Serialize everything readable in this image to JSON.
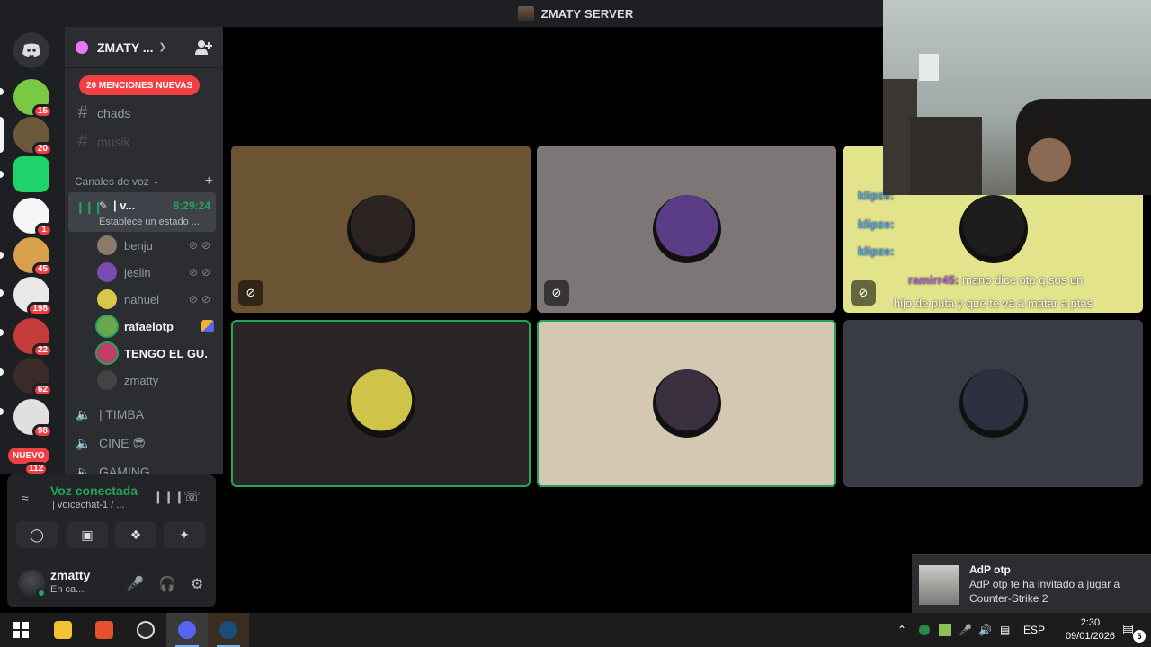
{
  "window": {
    "title": "ZMATY SERVER"
  },
  "servers": [
    {
      "badge": "15",
      "color": "#7ac943"
    },
    {
      "badge": "20",
      "color": "#6a5a3a"
    },
    {
      "badge": "",
      "color": "#1fd36a"
    },
    {
      "badge": "1",
      "color": "#f5f5f5"
    },
    {
      "badge": "45",
      "color": "#d8a04a"
    },
    {
      "badge": "198",
      "color": "#e8e8e8"
    },
    {
      "badge": "22",
      "color": "#c43b3b"
    },
    {
      "badge": "62",
      "color": "#3a2a2a"
    },
    {
      "badge": "98",
      "color": "#e0e0e0"
    }
  ],
  "rail": {
    "nuevo_label": "NUEVO",
    "nuevo_count": "112"
  },
  "sidebar": {
    "server_name": "ZMATY ...",
    "mentions_label": "20 MENCIONES NUEVAS",
    "text_channels": [
      {
        "name": "chads"
      },
      {
        "name": "musik"
      }
    ],
    "voice_category": "Canales de voz",
    "active_voice": {
      "name": "| v...",
      "timer": "8:29:24",
      "status": "Establece un estado ..."
    },
    "voice_users": [
      {
        "name": "benju",
        "color": "#8a7a6a"
      },
      {
        "name": "jeslin",
        "color": "#7a4bb0"
      },
      {
        "name": "nahuel",
        "color": "#d6c94a"
      },
      {
        "name": "rafaelotp",
        "color": "#6aa84f"
      },
      {
        "name": "TENGO EL GU...",
        "color": "#c23b6a"
      },
      {
        "name": "zmatty",
        "color": "#444"
      }
    ],
    "voice_channels": [
      {
        "name": "| TIMBA"
      },
      {
        "name": "CINE 😎"
      },
      {
        "name": "GAMING"
      }
    ]
  },
  "voice_panel": {
    "title": "Voz conectada",
    "subtitle": "| voicechat-1 / ...",
    "username": "zmatty",
    "user_status": "En ca..."
  },
  "tiles": [
    {
      "bg": "#6b5434",
      "ava": "#2b2421",
      "speaking": false,
      "camoff": true
    },
    {
      "bg": "#7d7676",
      "ava": "#5a3c87",
      "speaking": false,
      "camoff": true
    },
    {
      "bg": "#e2e38a",
      "ava": "#1d1d1d",
      "speaking": false,
      "camoff": true
    },
    {
      "bg": "#2a2627",
      "ava": "#cfc44a",
      "speaking": true,
      "camoff": false
    },
    {
      "bg": "#d4c8b2",
      "ava": "#3a3040",
      "speaking": true,
      "camoff": false
    },
    {
      "bg": "#3a3c45",
      "ava": "#2c3040",
      "speaking": false,
      "camoff": false
    }
  ],
  "stream_chat": [
    {
      "user": "klipze:",
      "msg": ""
    },
    {
      "user": "klipze:",
      "msg": ""
    },
    {
      "user": "klipze:",
      "msg": ""
    },
    {
      "user": "ramirr45:",
      "msg": " mano dice otp q sos un"
    },
    {
      "user": "",
      "msg": "hijo de puta y que te va a matar a ptas"
    }
  ],
  "notification": {
    "title": "AdP otp",
    "line1": "AdP otp te ha invitado a jugar a",
    "line2": "Counter-Strike 2"
  },
  "taskbar": {
    "lang": "ESP",
    "time": "2:30",
    "date": "09/01/2026",
    "notif_count": "5"
  }
}
